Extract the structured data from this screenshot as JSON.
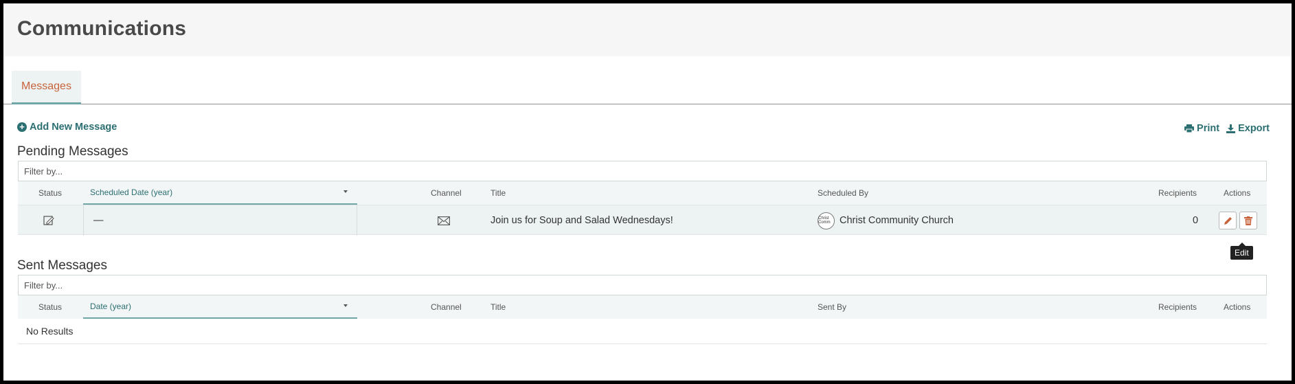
{
  "page": {
    "title": "Communications"
  },
  "tabs": [
    {
      "label": "Messages",
      "active": true
    }
  ],
  "toolbar": {
    "add_label": "Add New Message",
    "print_label": "Print",
    "export_label": "Export"
  },
  "pending": {
    "title": "Pending Messages",
    "filter_placeholder": "Filter by...",
    "columns": {
      "status": "Status",
      "date": "Scheduled Date (year)",
      "channel": "Channel",
      "title": "Title",
      "by": "Scheduled By",
      "recipients": "Recipients",
      "actions": "Actions"
    },
    "rows": [
      {
        "status_icon": "draft-icon",
        "date": "—",
        "channel_icon": "envelope-icon",
        "title": "Join us for Soup and Salad Wednesdays!",
        "avatar_text": "Christ Comm",
        "scheduled_by": "Christ Community Church",
        "recipients": "0"
      }
    ]
  },
  "sent": {
    "title": "Sent Messages",
    "filter_placeholder": "Filter by...",
    "columns": {
      "status": "Status",
      "date": "Date (year)",
      "channel": "Channel",
      "title": "Title",
      "by": "Sent By",
      "recipients": "Recipients",
      "actions": "Actions"
    },
    "empty_text": "No Results"
  },
  "tooltip": {
    "text": "Edit"
  },
  "colors": {
    "accent": "#2b6f72",
    "tab_text": "#c8623a",
    "action_icon": "#c8623a"
  }
}
